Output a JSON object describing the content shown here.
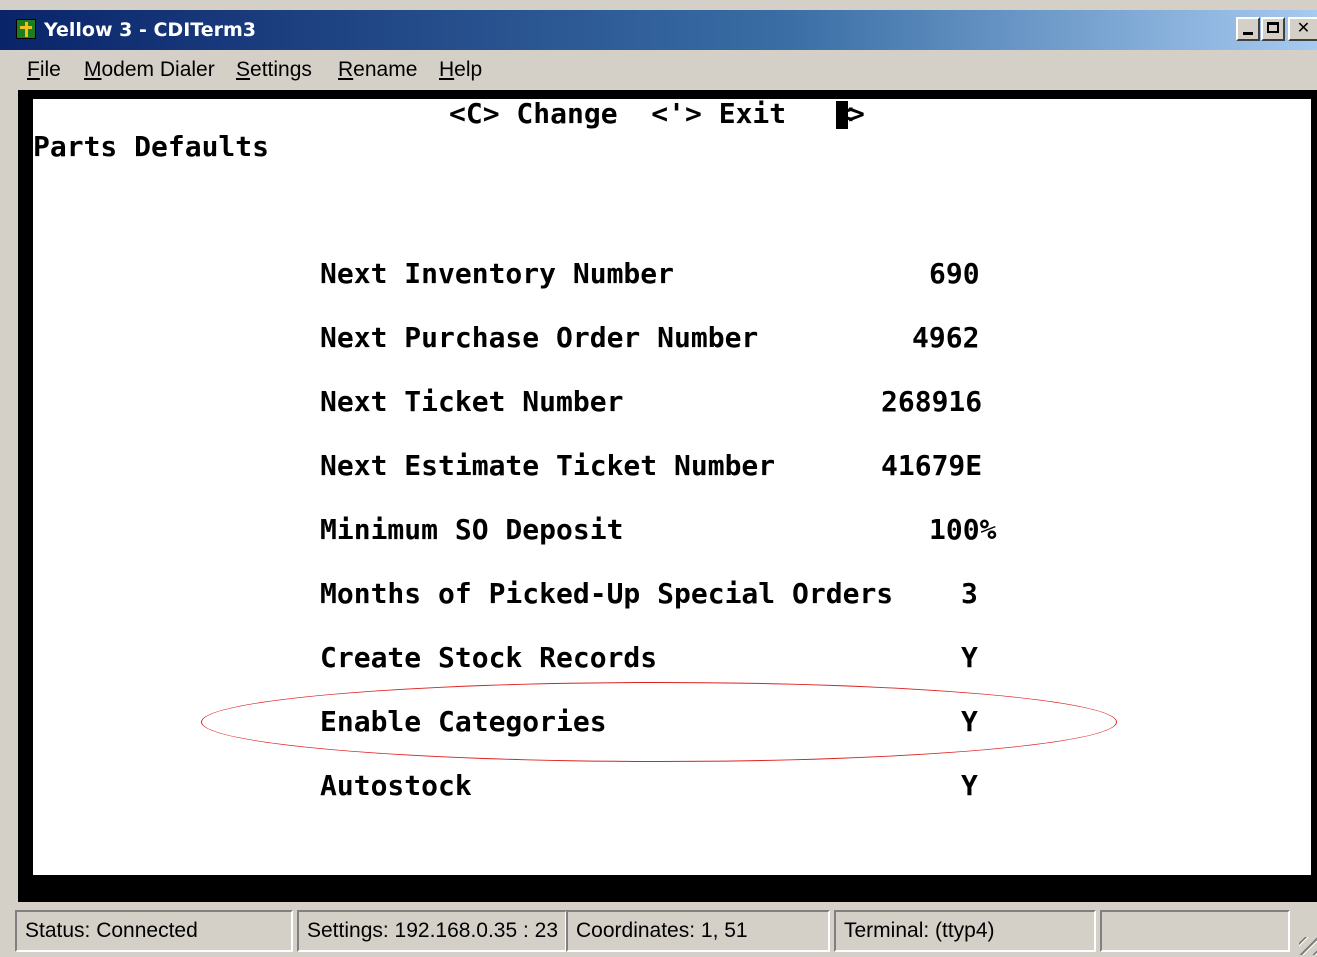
{
  "window": {
    "title": "Yellow 3 - CDITerm3",
    "icon": "cactus-app-icon"
  },
  "menu": [
    {
      "label": "File",
      "mnemonic": "F"
    },
    {
      "label": "Modem Dialer",
      "mnemonic": "M"
    },
    {
      "label": "Settings",
      "mnemonic": "S"
    },
    {
      "label": "Rename",
      "mnemonic": "R"
    },
    {
      "label": "Help",
      "mnemonic": "H"
    }
  ],
  "terminal": {
    "command_bar": "<C> Change  <'> Exit   <",
    "command_bar_end": ">",
    "screen_title": "Parts Defaults",
    "fields": [
      {
        "label": "Next Inventory Number",
        "value": "690"
      },
      {
        "label": "Next Purchase Order Number",
        "value": "4962"
      },
      {
        "label": "Next Ticket Number",
        "value": "268916"
      },
      {
        "label": "Next Estimate Ticket Number",
        "value": "41679E"
      },
      {
        "label": "Minimum SO Deposit",
        "value": "100%"
      },
      {
        "label": "Months of Picked-Up Special Orders",
        "value": "3"
      },
      {
        "label": "Create Stock Records",
        "value": "Y"
      },
      {
        "label": "Enable Categories",
        "value": "Y"
      },
      {
        "label": "Autostock",
        "value": "Y"
      }
    ],
    "highlight_color": "#dd2222"
  },
  "status": {
    "status": "Status:  Connected",
    "settings": "Settings: 192.168.0.35 : 23",
    "coordinates": "Coordinates:    1, 51",
    "terminal": "Terminal: (ttyp4)",
    "extra": ""
  }
}
